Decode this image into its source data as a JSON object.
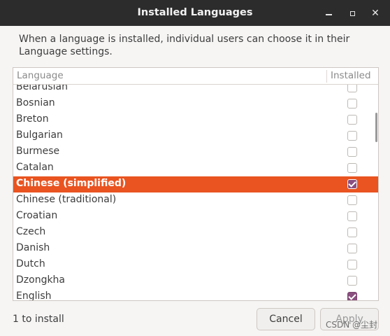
{
  "window": {
    "title": "Installed Languages"
  },
  "description": "When a language is installed, individual users can choose it in their Language settings.",
  "list": {
    "col_language": "Language",
    "col_installed": "Installed",
    "rows": [
      {
        "label": "Belarusian",
        "installed": false,
        "selected": false
      },
      {
        "label": "Bosnian",
        "installed": false,
        "selected": false
      },
      {
        "label": "Breton",
        "installed": false,
        "selected": false
      },
      {
        "label": "Bulgarian",
        "installed": false,
        "selected": false
      },
      {
        "label": "Burmese",
        "installed": false,
        "selected": false
      },
      {
        "label": "Catalan",
        "installed": false,
        "selected": false
      },
      {
        "label": "Chinese (simplified)",
        "installed": true,
        "selected": true
      },
      {
        "label": "Chinese (traditional)",
        "installed": false,
        "selected": false
      },
      {
        "label": "Croatian",
        "installed": false,
        "selected": false
      },
      {
        "label": "Czech",
        "installed": false,
        "selected": false
      },
      {
        "label": "Danish",
        "installed": false,
        "selected": false
      },
      {
        "label": "Dutch",
        "installed": false,
        "selected": false
      },
      {
        "label": "Dzongkha",
        "installed": false,
        "selected": false
      },
      {
        "label": "English",
        "installed": true,
        "selected": false
      }
    ]
  },
  "footer": {
    "status": "1 to install",
    "cancel_label": "Cancel",
    "apply_label": "Apply"
  },
  "watermark": "CSDN @尘封",
  "colors": {
    "selection": "#e95420",
    "checkbox_checked": "#8a4f7f",
    "titlebar": "#2c2c2c"
  }
}
